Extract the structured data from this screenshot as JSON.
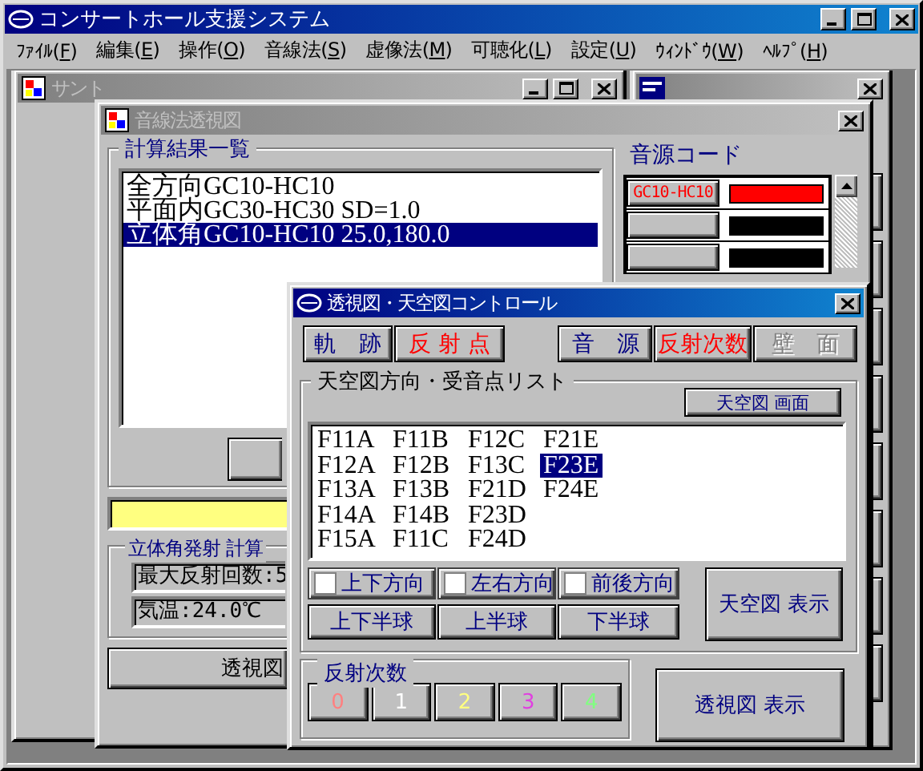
{
  "window": {
    "title": "コンサートホール支援システム"
  },
  "menu": [
    "ﾌｧｲﾙ(F)",
    "編集(E)",
    "操作(O)",
    "音線法(S)",
    "虚像法(M)",
    "可聴化(L)",
    "設定(U)",
    "ｳｨﾝﾄﾞｳ(W)",
    "ﾍﾙﾌﾟ(H)"
  ],
  "back_window": {
    "title": "サント",
    "active": false
  },
  "sound_window": {
    "title": "音線法透視図",
    "active": false,
    "results": {
      "label": "計算結果一覧",
      "items": [
        {
          "text": "全方向GC10-HC10",
          "selected": false
        },
        {
          "text": "平面内GC30-HC30 SD=1.0",
          "selected": false
        },
        {
          "text": "立体角GC10-HC10 25.0,180.0",
          "selected": true
        }
      ]
    },
    "calc": {
      "label": "立体角発射 計算",
      "fields": [
        "最大反射回数:5",
        "気温:24.0℃"
      ]
    },
    "show_button": "透視図",
    "sources": {
      "label": "音源コード",
      "rows": [
        {
          "code": "GC10-HC10",
          "color": "#ff0000"
        },
        {
          "color": "#000000"
        },
        {
          "color": "#000000"
        }
      ]
    }
  },
  "dialog": {
    "title": "透視図・天空図コントロール",
    "active": true,
    "toggles": [
      {
        "label": "軌　跡",
        "on": false,
        "disabled": false
      },
      {
        "label": "反 射 点",
        "on": true,
        "disabled": false
      },
      {
        "label": "音　源",
        "on": false,
        "disabled": false
      },
      {
        "label": "反射次数",
        "on": true,
        "disabled": false
      },
      {
        "label": "壁　面",
        "on": false,
        "disabled": true
      }
    ],
    "sky": {
      "label": "天空図方向・受音点リスト",
      "screen_button": "天空図 画面",
      "items": [
        {
          "text": "F11A",
          "selected": false
        },
        {
          "text": "F12A",
          "selected": false
        },
        {
          "text": "F13A",
          "selected": false
        },
        {
          "text": "F14A",
          "selected": false
        },
        {
          "text": "F15A",
          "selected": false
        },
        {
          "text": "F11B",
          "selected": false
        },
        {
          "text": "F12B",
          "selected": false
        },
        {
          "text": "F13B",
          "selected": false
        },
        {
          "text": "F14B",
          "selected": false
        },
        {
          "text": "F11C",
          "selected": false
        },
        {
          "text": "F12C",
          "selected": false
        },
        {
          "text": "F13C",
          "selected": false
        },
        {
          "text": "F21D",
          "selected": false
        },
        {
          "text": "F23D",
          "selected": false
        },
        {
          "text": "F24D",
          "selected": false
        },
        {
          "text": "F21E",
          "selected": false
        },
        {
          "text": "F23E",
          "selected": true
        },
        {
          "text": "F24E",
          "selected": false
        }
      ],
      "checks": [
        {
          "label": "上下方向",
          "checked": false
        },
        {
          "label": "左右方向",
          "checked": false
        },
        {
          "label": "前後方向",
          "checked": false
        }
      ],
      "hemispheres": [
        "上下半球",
        "上半球",
        "下半球"
      ],
      "show_button": "天空図 表示"
    },
    "orders": {
      "label": "反射次数",
      "buttons": [
        {
          "label": "0",
          "color": "#ff8080"
        },
        {
          "label": "1",
          "color": "#ffffff"
        },
        {
          "label": "2",
          "color": "#ffff80"
        },
        {
          "label": "3",
          "color": "#e040e0"
        },
        {
          "label": "4",
          "color": "#80ff80"
        }
      ]
    },
    "show_button": "透視図 表示"
  }
}
